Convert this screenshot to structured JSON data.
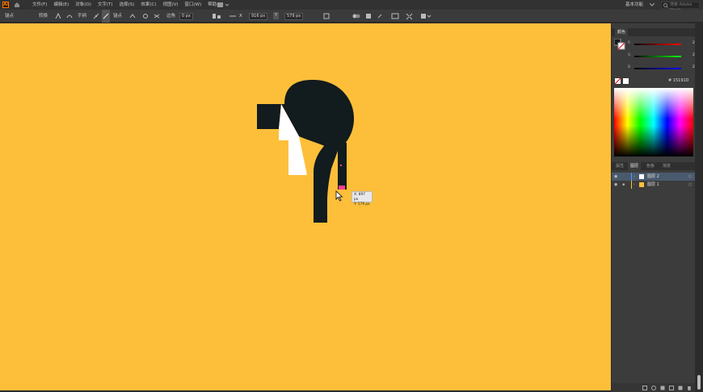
{
  "menubar": {
    "logo": "Ai",
    "menus": [
      "文件(F)",
      "编辑(E)",
      "对象(O)",
      "文字(T)",
      "选择(S)",
      "效果(C)",
      "视图(V)",
      "窗口(W)",
      "帮助(H)"
    ],
    "workspace": "基本功能",
    "search_placeholder": "搜索 Adobe Stock"
  },
  "control_bar": {
    "anchor_label": "锚点",
    "convert_label": "转换",
    "handle_label": "手柄",
    "anchor2_label": "锚点",
    "corner_label": "边角",
    "corner_value": "0 px",
    "x_label": "X",
    "x_value": "916 px",
    "y_label": "Y",
    "y_value": "579 px"
  },
  "tooltip": {
    "x": "X: 897 px",
    "y": "Y: 579 px"
  },
  "color_panel": {
    "tab": "颜色",
    "r": {
      "label": "R",
      "value": "21"
    },
    "g": {
      "label": "G",
      "value": "29"
    },
    "b": {
      "label": "B",
      "value": "29"
    },
    "hex": "15191D",
    "accent": "#15191d"
  },
  "layers_panel": {
    "tabs": [
      "属性",
      "图层",
      "色板",
      "渐变"
    ],
    "active_tab": "图层",
    "layers": [
      {
        "name": "图层 2",
        "color": "#4a9cf0",
        "selected": true
      },
      {
        "name": "图层 1",
        "color": "#fdbf39",
        "selected": false
      }
    ]
  },
  "artboard": {
    "background": "#fdbf39",
    "shape_color": "#121b1d"
  }
}
